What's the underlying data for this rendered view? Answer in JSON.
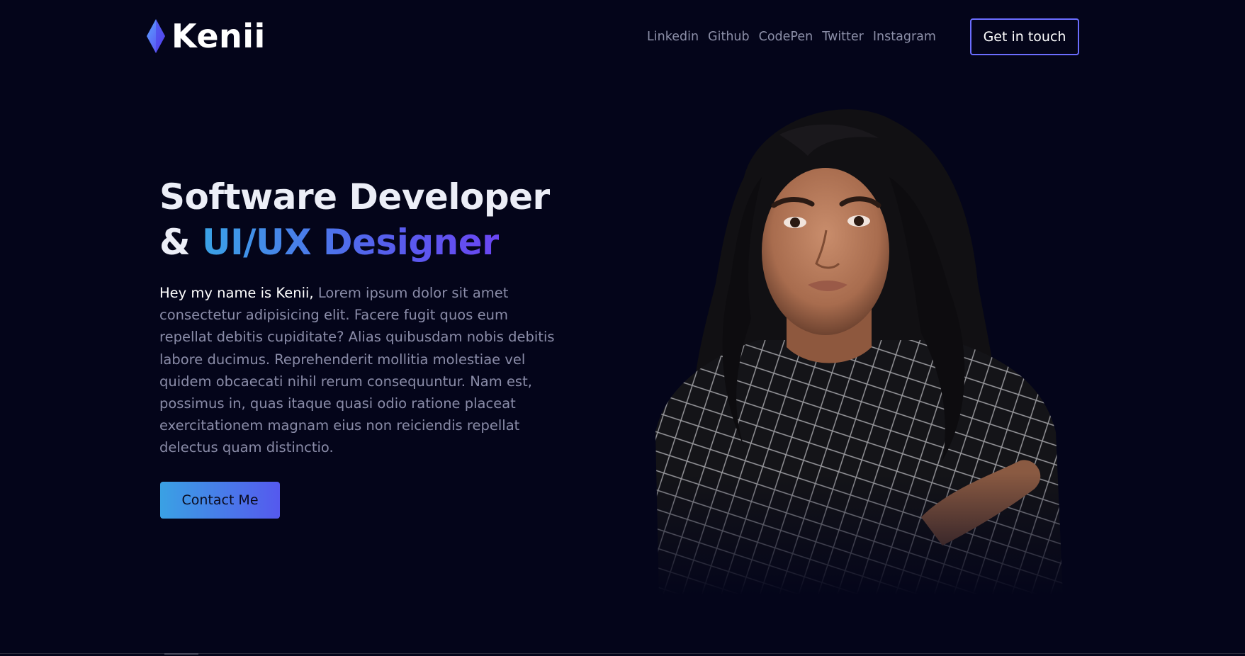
{
  "brand": {
    "name": "Kenii",
    "logo_icon": "diamond-icon"
  },
  "nav": {
    "links": [
      "Linkedin",
      "Github",
      "CodePen",
      "Twitter",
      "Instagram"
    ],
    "cta_label": "Get in touch"
  },
  "hero": {
    "headline_line1": "Software Developer",
    "headline_line2_prefix": "& ",
    "headline_line2_accent": "UI/UX Designer",
    "intro": "Hey my name is Kenii,",
    "body": " Lorem ipsum dolor sit amet consectetur adipisicing elit. Facere fugit quos eum repellat debitis cupiditate? Alias quibusdam nobis debitis labore ducimus. Reprehenderit mollitia molestiae vel quidem obcaecati nihil rerum consequuntur. Nam est, possimus in, quas itaque quasi odio ratione placeat exercitationem magnam eius non reiciendis repellat delectus quam distinctio.",
    "button_label": "Contact Me"
  },
  "colors": {
    "background": "#04051a",
    "accent_start": "#3aa3e6",
    "accent_end": "#6a46f2",
    "muted_text": "#8a8ca8",
    "outline_button": "#6b6dff"
  }
}
